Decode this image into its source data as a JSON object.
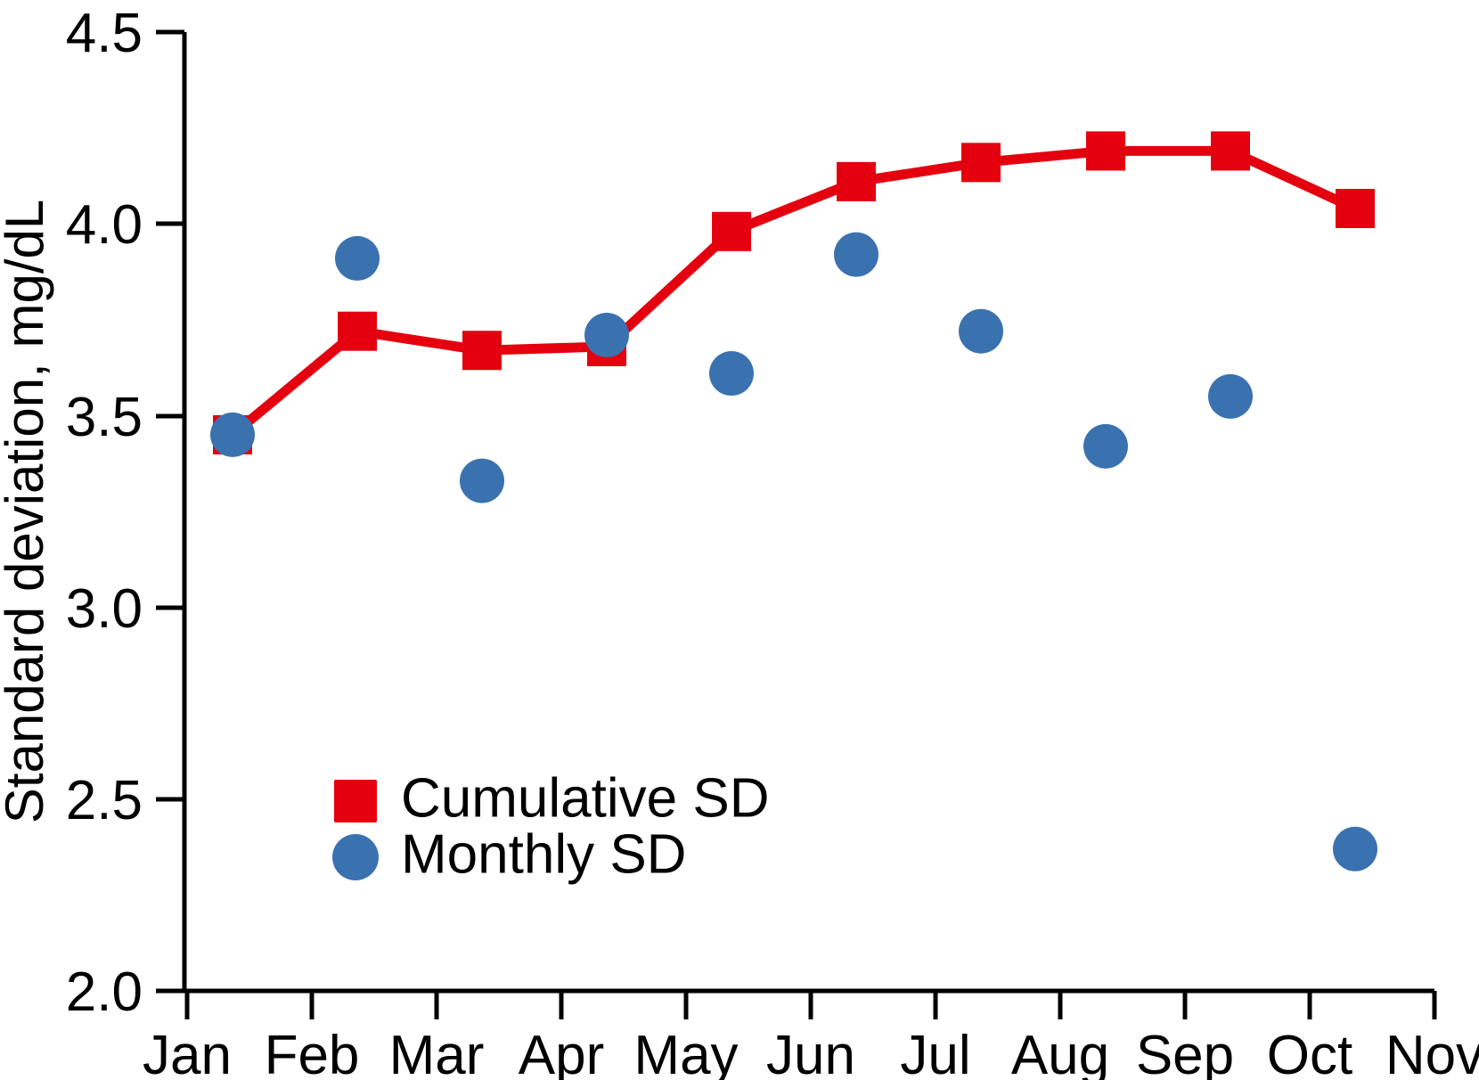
{
  "chart_data": {
    "type": "line",
    "title": "",
    "subtitle": "",
    "xlabel": "",
    "ylabel": "Standard deviation, mg/dL",
    "xlim": [
      0,
      10
    ],
    "ylim": [
      2.0,
      4.5
    ],
    "grid": false,
    "legend_position": "inside-bottom-left",
    "x_tick_labels": [
      "Jan",
      "Feb",
      "Mar",
      "Apr",
      "May",
      "Jun",
      "Jul",
      "Aug",
      "Sep",
      "Oct",
      "Nov"
    ],
    "y_tick_labels": [
      "2.0",
      "2.5",
      "3.0",
      "3.5",
      "4.0",
      "4.5"
    ],
    "y_ticks": [
      2.0,
      2.5,
      3.0,
      3.5,
      4.0,
      4.5
    ],
    "categories": [
      "Jan",
      "Feb",
      "Mar",
      "Apr",
      "May",
      "Jun",
      "Jul",
      "Aug",
      "Sep",
      "Oct"
    ],
    "series": [
      {
        "name": "Cumulative SD",
        "color": "#E4000E",
        "marker": "square",
        "has_line": true,
        "values": [
          3.45,
          3.72,
          3.67,
          3.68,
          3.98,
          4.11,
          4.16,
          4.19,
          4.19,
          4.04
        ]
      },
      {
        "name": "Monthly SD",
        "color": "#3A72B0",
        "marker": "circle",
        "has_line": false,
        "values": [
          3.45,
          3.91,
          3.33,
          3.71,
          3.61,
          3.92,
          3.72,
          3.42,
          3.55,
          2.37
        ]
      }
    ]
  },
  "legend": {
    "items": [
      {
        "label": "Cumulative SD",
        "color": "#E4000E",
        "marker": "square"
      },
      {
        "label": "Monthly SD",
        "color": "#3A72B0",
        "marker": "circle"
      }
    ]
  },
  "axes": {
    "y_title": "Standard deviation, mg/dL"
  },
  "colors": {
    "cumulative": "#E4000E",
    "monthly": "#3A72B0",
    "axis": "#000000",
    "background": "#ffffff"
  }
}
